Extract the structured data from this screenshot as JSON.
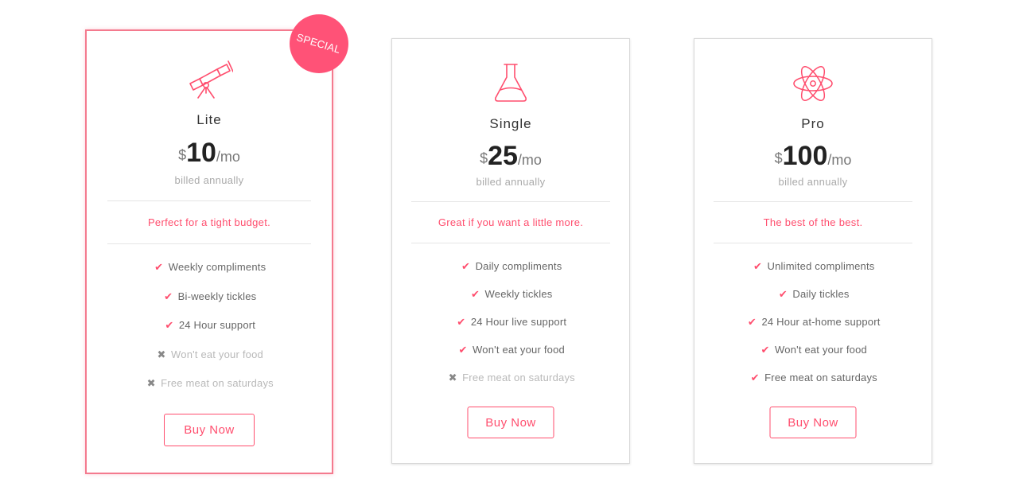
{
  "accent_color": "#ff4e6e",
  "badge": {
    "label": "SPECIAL"
  },
  "plans": [
    {
      "icon": "telescope-icon",
      "name": "Lite",
      "currency": "$",
      "amount": "10",
      "period": "/mo",
      "billing": "billed annually",
      "tagline": "Perfect for a tight budget.",
      "features": [
        {
          "text": "Weekly compliments",
          "included": true
        },
        {
          "text": "Bi-weekly tickles",
          "included": true
        },
        {
          "text": "24 Hour support",
          "included": true
        },
        {
          "text": "Won't eat your food",
          "included": false
        },
        {
          "text": "Free meat on saturdays",
          "included": false
        }
      ],
      "button": "Buy Now"
    },
    {
      "icon": "flask-icon",
      "name": "Single",
      "currency": "$",
      "amount": "25",
      "period": "/mo",
      "billing": "billed annually",
      "tagline": "Great if you want a little more.",
      "features": [
        {
          "text": "Daily compliments",
          "included": true
        },
        {
          "text": "Weekly tickles",
          "included": true
        },
        {
          "text": "24 Hour live support",
          "included": true
        },
        {
          "text": "Won't eat your food",
          "included": true
        },
        {
          "text": "Free meat on saturdays",
          "included": false
        }
      ],
      "button": "Buy Now"
    },
    {
      "icon": "atom-icon",
      "name": "Pro",
      "currency": "$",
      "amount": "100",
      "period": "/mo",
      "billing": "billed annually",
      "tagline": "The best of the best.",
      "features": [
        {
          "text": "Unlimited compliments",
          "included": true
        },
        {
          "text": "Daily tickles",
          "included": true
        },
        {
          "text": "24 Hour at-home support",
          "included": true
        },
        {
          "text": "Won't eat your food",
          "included": true
        },
        {
          "text": "Free meat on saturdays",
          "included": true
        }
      ],
      "button": "Buy Now"
    }
  ]
}
